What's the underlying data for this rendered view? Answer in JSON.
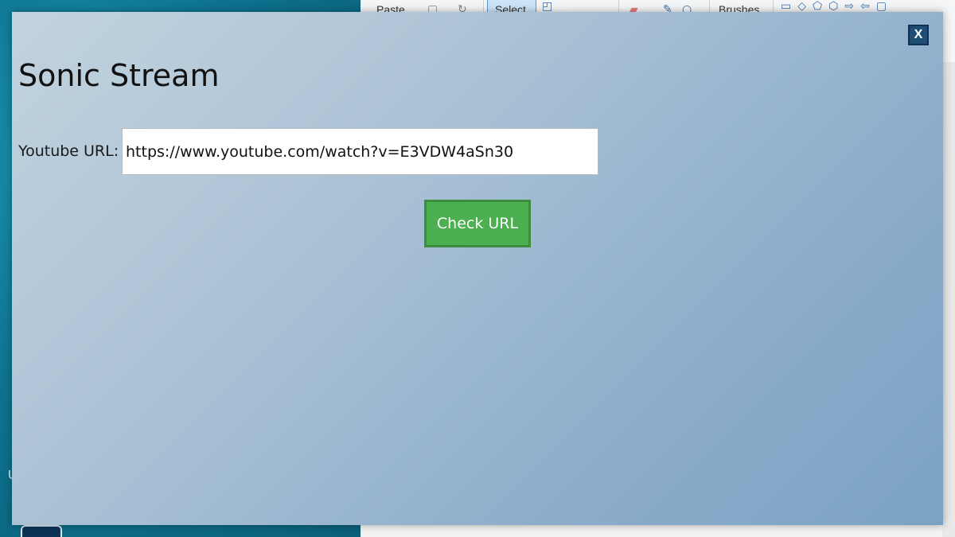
{
  "desktop": {
    "glyph": "U"
  },
  "paint": {
    "ribbon": {
      "paste_label": "Paste",
      "select_label": "Select",
      "brushes_label": "Brushes",
      "shapes_glyphs": "▭◇⬠⬡⇨⇦▢"
    }
  },
  "dialog": {
    "title": "Sonic Stream",
    "close_label": "X",
    "url_label": "Youtube URL:",
    "url_value": "https://www.youtube.com/watch?v=E3VDW4aSn30",
    "check_button_label": "Check URL"
  },
  "colors": {
    "accent_green": "#4caf50",
    "close_button": "#1e4e73",
    "dialog_gradient_start": "#c2d3df",
    "dialog_gradient_end": "#7ba2c4"
  }
}
